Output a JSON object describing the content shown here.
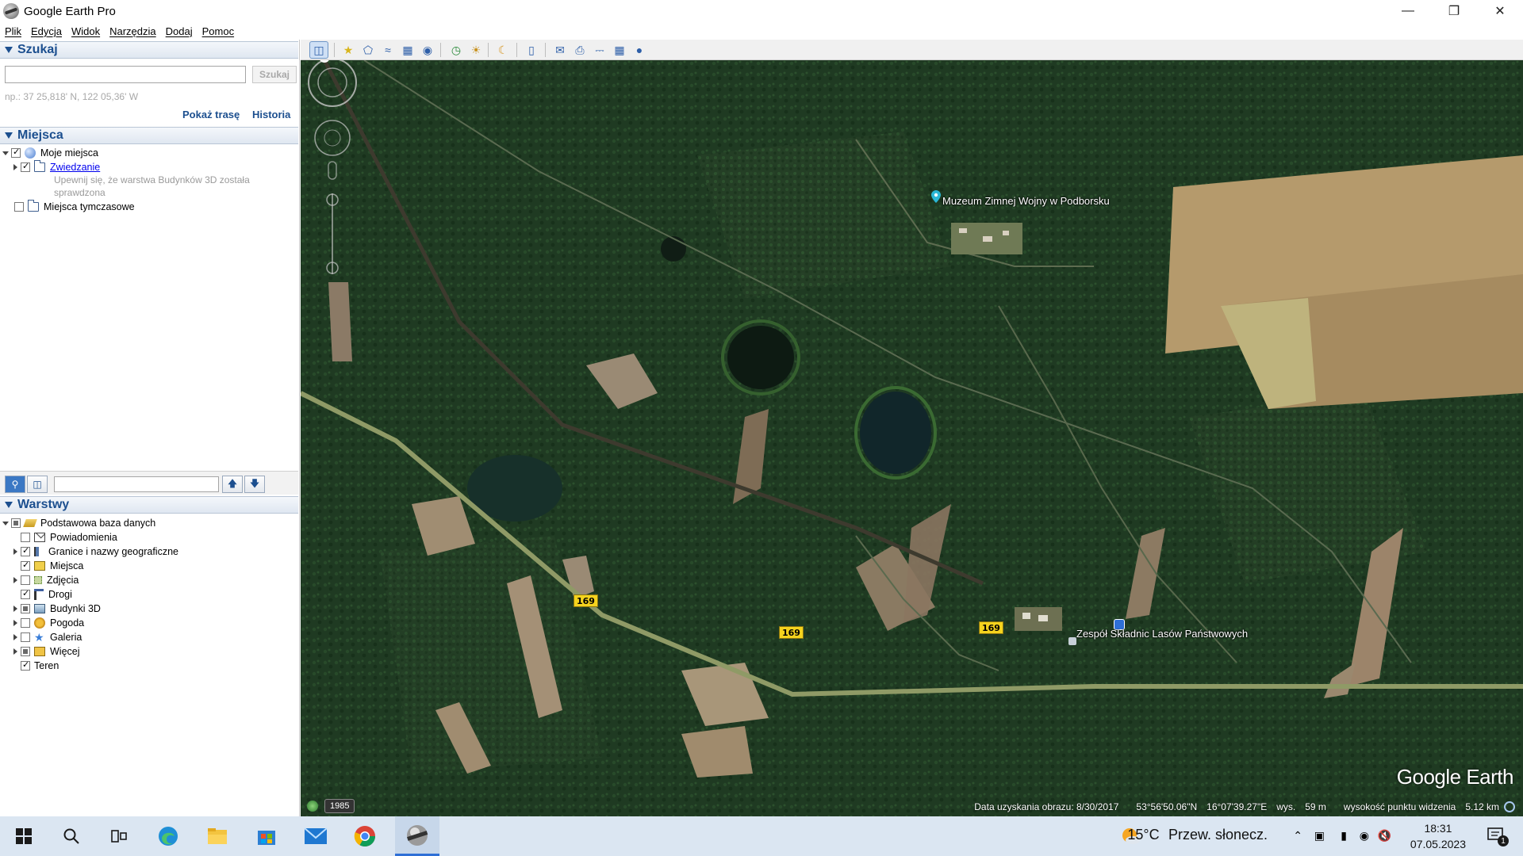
{
  "window": {
    "title": "Google Earth Pro",
    "controls": [
      "minimize",
      "restore",
      "close"
    ]
  },
  "menu": [
    "Plik",
    "Edycja",
    "Widok",
    "Narzędzia",
    "Dodaj",
    "Pomoc"
  ],
  "search": {
    "header": "Szukaj",
    "input_value": "",
    "button_label": "Szukaj",
    "hint": "np.: 37 25,818' N, 122 05,36' W",
    "route_link": "Pokaż trasę",
    "history_link": "Historia"
  },
  "places": {
    "header": "Miejsca",
    "items": [
      {
        "label": "Moje miejsca",
        "checked": "on",
        "expanded": true
      },
      {
        "label": "Zwiedzanie",
        "checked": "on",
        "link": true
      },
      {
        "note": "Upewnij się, że warstwa Budynków 3D została sprawdzona"
      },
      {
        "label": "Miejsca tymczasowe",
        "checked": "off"
      }
    ]
  },
  "layers": {
    "header": "Warstwy",
    "root": {
      "label": "Podstawowa baza danych",
      "checked": "partial"
    },
    "items": [
      {
        "label": "Powiadomienia",
        "checked": "off",
        "icon": "envelope-icon"
      },
      {
        "label": "Granice i nazwy geograficzne",
        "checked": "on",
        "icon": "border-flag-icon"
      },
      {
        "label": "Miejsca",
        "checked": "on",
        "icon": "places-icon"
      },
      {
        "label": "Zdjęcia",
        "checked": "off",
        "icon": "photo-icon"
      },
      {
        "label": "Drogi",
        "checked": "on",
        "icon": "road-icon"
      },
      {
        "label": "Budynki 3D",
        "checked": "partial",
        "icon": "building-icon"
      },
      {
        "label": "Pogoda",
        "checked": "off",
        "icon": "weather-sun-icon"
      },
      {
        "label": "Galeria",
        "checked": "off",
        "icon": "gallery-star-icon"
      },
      {
        "label": "Więcej",
        "checked": "partial",
        "icon": "more-icon"
      }
    ],
    "terrain": {
      "label": "Teren",
      "checked": "on"
    }
  },
  "map": {
    "placemarks": [
      {
        "label": "Muzeum Zimnej Wojny w Podborsku"
      },
      {
        "label": "Zespół Składnic Lasów Państwowych"
      }
    ],
    "road_labels": [
      "169",
      "169",
      "169"
    ],
    "logo": "Google Earth",
    "historical_year": "1985",
    "status": {
      "imagery_date": "Data uzyskania obrazu: 8/30/2017",
      "lat": "53°56'50.06\"N",
      "lon": "16°07'39.27\"E",
      "elev_label": "wys.",
      "elev": "59 m",
      "eye_label": "wysokość punktu widzenia",
      "eye": "5.12 km"
    },
    "compass_north": "N"
  },
  "taskbar": {
    "weather_temp": "15°C",
    "weather_desc": "Przew. słonecz.",
    "time": "18:31",
    "date": "07.05.2023",
    "notifications": "1"
  },
  "colors": {
    "header_blue": "#1c4f8f",
    "forest": "#1c3620",
    "taskbar": "#dbe6f2"
  }
}
